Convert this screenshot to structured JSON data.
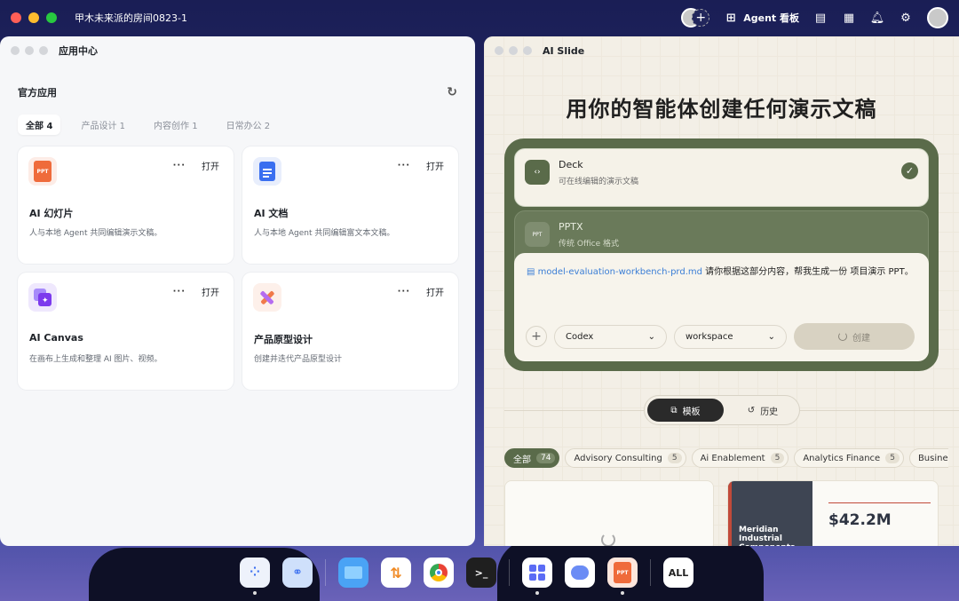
{
  "topbar": {
    "title": "甲木未来派的房间0823-1",
    "agent_board": "Agent 看板"
  },
  "left_window": {
    "title": "应用中心",
    "section_title": "官方应用",
    "tabs": [
      {
        "label": "全部",
        "count": "4"
      },
      {
        "label": "产品设计",
        "count": "1"
      },
      {
        "label": "内容创作",
        "count": "1"
      },
      {
        "label": "日常办公",
        "count": "2"
      }
    ],
    "cards": [
      {
        "title": "AI 幻灯片",
        "desc": "人与本地 Agent 共同编辑演示文稿。",
        "icon": "ppt-icon",
        "icon_text": "PPT",
        "action": "打开",
        "more": "···"
      },
      {
        "title": "AI 文档",
        "desc": "人与本地 Agent 共同编辑富文本文稿。",
        "icon": "doc-icon",
        "action": "打开",
        "more": "···"
      },
      {
        "title": "AI Canvas",
        "desc": "在画布上生成和整理 AI 图片、视频。",
        "icon": "canvas-icon",
        "action": "打开",
        "more": "···"
      },
      {
        "title": "产品原型设计",
        "desc": "创建并迭代产品原型设计",
        "icon": "pen-icon",
        "action": "打开",
        "more": "···"
      }
    ]
  },
  "right_window": {
    "title": "AI Slide",
    "hero": "用你的智能体创建任何演示文稿",
    "options": [
      {
        "name": "Deck",
        "sub": "可在线编辑的演示文稿",
        "selected": true
      },
      {
        "name": "PPTX",
        "sub": "传统 Office 格式",
        "icon_text": "PPT"
      }
    ],
    "prompt": {
      "file": "model-evaluation-workbench-prd.md",
      "text": " 请你根据这部分内容，帮我生成一份 项目演示 PPT。"
    },
    "agent_select": "Codex",
    "workspace_select": "workspace",
    "create_button": "创建",
    "switch": {
      "templates": "模板",
      "history": "历史"
    },
    "chips": [
      {
        "label": "全部",
        "count": "74"
      },
      {
        "label": "Advisory Consulting",
        "count": "5"
      },
      {
        "label": "Ai Enablement",
        "count": "5"
      },
      {
        "label": "Analytics Finance",
        "count": "5"
      },
      {
        "label": "Busine",
        "count": ""
      }
    ],
    "thumb2": {
      "title": "Meridian Industrial Components",
      "value": "$42.2M"
    }
  },
  "dock": {
    "all_label": "ALL",
    "ppt_label": "PPT"
  },
  "colors": {
    "accent_green": "#5a6b4a",
    "link_blue": "#3b7ed6"
  }
}
